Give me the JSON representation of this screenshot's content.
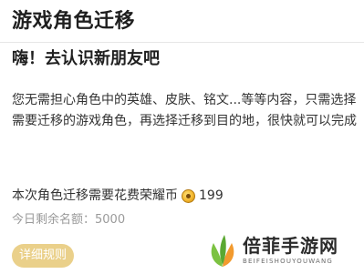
{
  "page": {
    "title": "游戏角色迁移",
    "headline": "嗨！去认识新朋友吧",
    "description": "您无需担心角色中的英雄、皮肤、铭文...等等内容，只需选择需要迁移的游戏角色，再选择迁移到目的地，很快就可以完成",
    "cost_label": "本次角色迁移需要花费荣耀币",
    "cost_value": "199",
    "cost_icon": "coin-icon",
    "remaining_label": "今日剩余名额：5000",
    "detail_button": "详细规则"
  },
  "watermark": {
    "name_cn": "倍菲手游网",
    "name_en": "BEIFEISHOUYOUWANG",
    "logo_icon": "leaf-logo-icon"
  },
  "colors": {
    "button_bg": "#ead08a",
    "muted_text": "#9a9a9a",
    "logo_green": "#7cc242",
    "logo_orange": "#f29a2e"
  }
}
